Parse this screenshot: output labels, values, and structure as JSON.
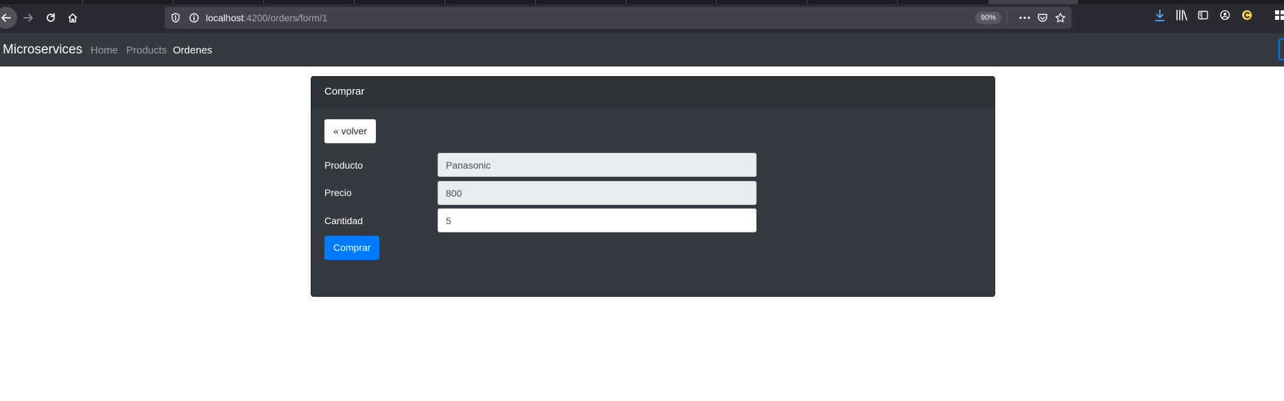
{
  "browser": {
    "url_host": "localhost",
    "url_path": ":4200/orders/form/1",
    "zoom": "90%"
  },
  "navbar": {
    "brand": "Microservices",
    "links": [
      {
        "label": "Home",
        "active": false
      },
      {
        "label": "Products",
        "active": false
      },
      {
        "label": "Ordenes",
        "active": true
      }
    ]
  },
  "card": {
    "header": "Comprar",
    "back_label": "« volver",
    "fields": [
      {
        "label": "Producto",
        "value": "Panasonic",
        "readonly": true
      },
      {
        "label": "Precio",
        "value": "800",
        "readonly": true
      },
      {
        "label": "Cantidad",
        "value": "5",
        "readonly": false
      }
    ],
    "submit_label": "Comprar"
  },
  "colors": {
    "navbar_bg": "#343a40",
    "primary": "#007bff",
    "readonly_bg": "#e9ecef"
  }
}
